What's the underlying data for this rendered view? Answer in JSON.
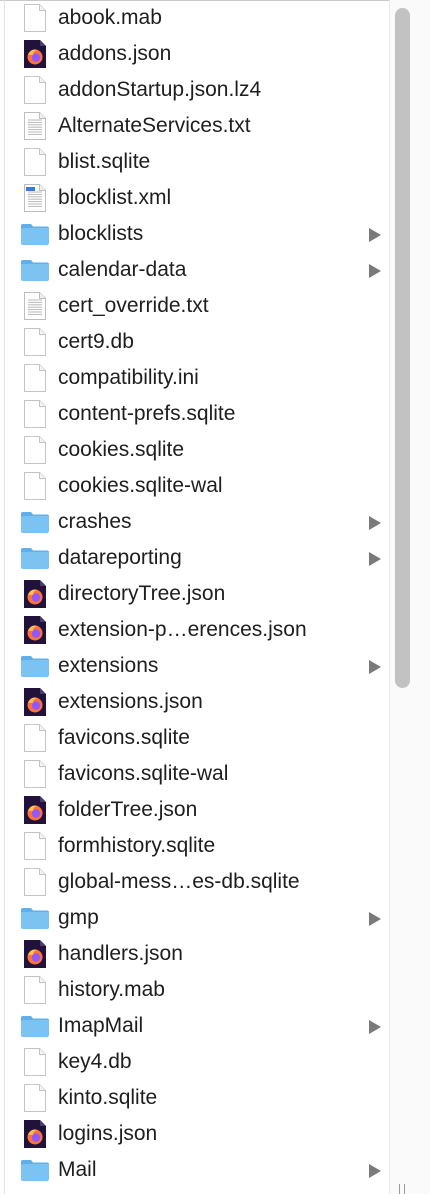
{
  "files": [
    {
      "name": "abook.mab",
      "icon": "blank-file-icon",
      "folder": false
    },
    {
      "name": "addons.json",
      "icon": "firefox-file-icon",
      "folder": false
    },
    {
      "name": "addonStartup.json.lz4",
      "icon": "blank-file-icon",
      "folder": false
    },
    {
      "name": "AlternateServices.txt",
      "icon": "text-file-icon",
      "folder": false
    },
    {
      "name": "blist.sqlite",
      "icon": "blank-file-icon",
      "folder": false
    },
    {
      "name": "blocklist.xml",
      "icon": "xml-file-icon",
      "folder": false
    },
    {
      "name": "blocklists",
      "icon": "folder-icon",
      "folder": true
    },
    {
      "name": "calendar-data",
      "icon": "folder-icon",
      "folder": true
    },
    {
      "name": "cert_override.txt",
      "icon": "text-file-icon",
      "folder": false
    },
    {
      "name": "cert9.db",
      "icon": "blank-file-icon",
      "folder": false
    },
    {
      "name": "compatibility.ini",
      "icon": "blank-file-icon",
      "folder": false
    },
    {
      "name": "content-prefs.sqlite",
      "icon": "blank-file-icon",
      "folder": false
    },
    {
      "name": "cookies.sqlite",
      "icon": "blank-file-icon",
      "folder": false
    },
    {
      "name": "cookies.sqlite-wal",
      "icon": "blank-file-icon",
      "folder": false
    },
    {
      "name": "crashes",
      "icon": "folder-icon",
      "folder": true
    },
    {
      "name": "datareporting",
      "icon": "folder-icon",
      "folder": true
    },
    {
      "name": "directoryTree.json",
      "icon": "firefox-file-icon",
      "folder": false
    },
    {
      "name": "extension-p…erences.json",
      "icon": "firefox-file-icon",
      "folder": false
    },
    {
      "name": "extensions",
      "icon": "folder-icon",
      "folder": true
    },
    {
      "name": "extensions.json",
      "icon": "firefox-file-icon",
      "folder": false
    },
    {
      "name": "favicons.sqlite",
      "icon": "blank-file-icon",
      "folder": false
    },
    {
      "name": "favicons.sqlite-wal",
      "icon": "blank-file-icon",
      "folder": false
    },
    {
      "name": "folderTree.json",
      "icon": "firefox-file-icon",
      "folder": false
    },
    {
      "name": "formhistory.sqlite",
      "icon": "blank-file-icon",
      "folder": false
    },
    {
      "name": "global-mess…es-db.sqlite",
      "icon": "blank-file-icon",
      "folder": false
    },
    {
      "name": "gmp",
      "icon": "folder-icon",
      "folder": true
    },
    {
      "name": "handlers.json",
      "icon": "firefox-file-icon",
      "folder": false
    },
    {
      "name": "history.mab",
      "icon": "blank-file-icon",
      "folder": false
    },
    {
      "name": "ImapMail",
      "icon": "folder-icon",
      "folder": true
    },
    {
      "name": "key4.db",
      "icon": "blank-file-icon",
      "folder": false
    },
    {
      "name": "kinto.sqlite",
      "icon": "blank-file-icon",
      "folder": false
    },
    {
      "name": "logins.json",
      "icon": "firefox-file-icon",
      "folder": false
    },
    {
      "name": "Mail",
      "icon": "folder-icon",
      "folder": true
    }
  ],
  "colors": {
    "folder": "#7cc3f2",
    "folder_tab": "#5fb0e8",
    "firefox_bg": "#20123a",
    "firefox_orange": "#ff7139",
    "firefox_purple": "#9059ff",
    "chevron": "#7a7a7a",
    "scroll_thumb": "#c2c2c2"
  }
}
